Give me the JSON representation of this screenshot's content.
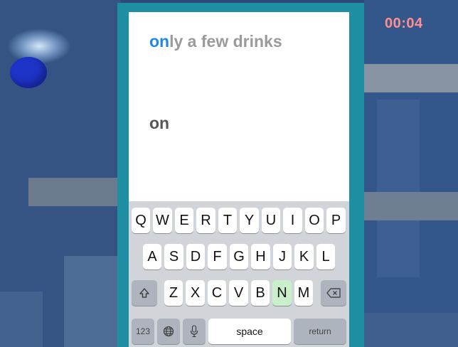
{
  "timer": "00:04",
  "prompt": {
    "typed_part": "on",
    "remaining_part": "ly a few drinks"
  },
  "input": {
    "value": "on"
  },
  "keyboard": {
    "row1": [
      "Q",
      "W",
      "E",
      "R",
      "T",
      "Y",
      "U",
      "I",
      "O",
      "P"
    ],
    "row2": [
      "A",
      "S",
      "D",
      "F",
      "G",
      "H",
      "J",
      "K",
      "L"
    ],
    "row3": [
      "Z",
      "X",
      "C",
      "V",
      "B",
      "N",
      "M"
    ],
    "highlighted_key": "N",
    "numbers_label": "123",
    "space_label": "space",
    "return_label": "return"
  },
  "icons": {
    "shift": "shift-icon",
    "backspace": "backspace-icon",
    "globe": "globe-icon",
    "microphone": "microphone-icon"
  },
  "colors": {
    "timer": "#ff8f8f",
    "typed_prompt": "#1f86e6",
    "remaining_prompt": "#9a9a9a",
    "device_frame": "#1e8fa3",
    "highlighted_key": "#c9efcb"
  }
}
